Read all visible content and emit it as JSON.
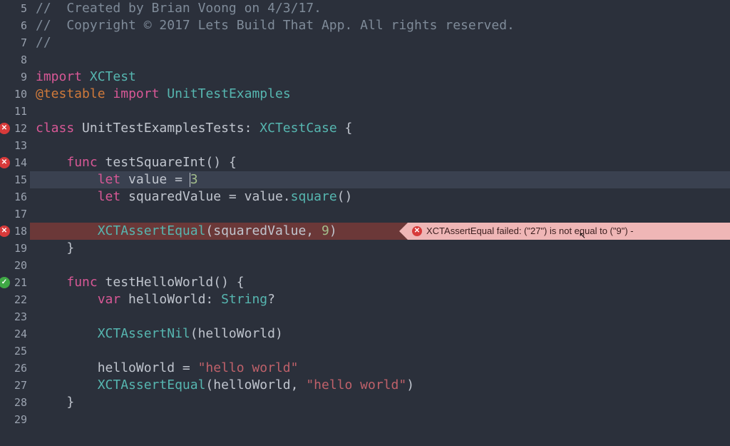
{
  "gutter": {
    "start": 5,
    "end": 29,
    "markers": {
      "12": "err",
      "14": "err",
      "18": "err",
      "21": "ok"
    }
  },
  "code": {
    "l5": {
      "tokens": [
        {
          "t": "//  Created by Brian Voong on 4/3/17.",
          "c": "comment"
        }
      ]
    },
    "l6": {
      "tokens": [
        {
          "t": "//  Copyright © 2017 Lets Build That App. All rights reserved.",
          "c": "comment"
        }
      ]
    },
    "l7": {
      "tokens": [
        {
          "t": "//",
          "c": "comment"
        }
      ]
    },
    "l8": {
      "tokens": []
    },
    "l9": {
      "tokens": [
        {
          "t": "import",
          "c": "keyword"
        },
        {
          "t": " ",
          "c": "plain"
        },
        {
          "t": "XCTest",
          "c": "type"
        }
      ]
    },
    "l10": {
      "tokens": [
        {
          "t": "@testable",
          "c": "attrib"
        },
        {
          "t": " ",
          "c": "plain"
        },
        {
          "t": "import",
          "c": "keyword"
        },
        {
          "t": " ",
          "c": "plain"
        },
        {
          "t": "UnitTestExamples",
          "c": "type"
        }
      ]
    },
    "l11": {
      "tokens": []
    },
    "l12": {
      "tokens": [
        {
          "t": "class",
          "c": "keyword"
        },
        {
          "t": " ",
          "c": "plain"
        },
        {
          "t": "UnitTestExamplesTests",
          "c": "ident"
        },
        {
          "t": ": ",
          "c": "plain"
        },
        {
          "t": "XCTestCase",
          "c": "type"
        },
        {
          "t": " {",
          "c": "plain"
        }
      ]
    },
    "l13": {
      "tokens": []
    },
    "l14": {
      "tokens": [
        {
          "t": "    ",
          "c": "plain"
        },
        {
          "t": "func",
          "c": "keyword"
        },
        {
          "t": " testSquareInt() {",
          "c": "plain"
        }
      ]
    },
    "l15": {
      "tokens": [
        {
          "t": "        ",
          "c": "plain"
        },
        {
          "t": "let",
          "c": "keyword"
        },
        {
          "t": " value = ",
          "c": "plain"
        },
        {
          "t": "3",
          "c": "number",
          "cursorBefore": true
        }
      ]
    },
    "l16": {
      "tokens": [
        {
          "t": "        ",
          "c": "plain"
        },
        {
          "t": "let",
          "c": "keyword"
        },
        {
          "t": " squaredValue = value.",
          "c": "plain"
        },
        {
          "t": "square",
          "c": "func"
        },
        {
          "t": "()",
          "c": "plain"
        }
      ]
    },
    "l17": {
      "tokens": []
    },
    "l18": {
      "tokens": [
        {
          "t": "        ",
          "c": "plain"
        },
        {
          "t": "XCTAssertEqual",
          "c": "func"
        },
        {
          "t": "(squaredValue, ",
          "c": "plain"
        },
        {
          "t": "9",
          "c": "number"
        },
        {
          "t": ")",
          "c": "plain"
        }
      ]
    },
    "l19": {
      "tokens": [
        {
          "t": "    }",
          "c": "plain"
        }
      ]
    },
    "l20": {
      "tokens": []
    },
    "l21": {
      "tokens": [
        {
          "t": "    ",
          "c": "plain"
        },
        {
          "t": "func",
          "c": "keyword"
        },
        {
          "t": " testHelloWorld() {",
          "c": "plain"
        }
      ]
    },
    "l22": {
      "tokens": [
        {
          "t": "        ",
          "c": "plain"
        },
        {
          "t": "var",
          "c": "keyword"
        },
        {
          "t": " helloWorld: ",
          "c": "plain"
        },
        {
          "t": "String",
          "c": "type"
        },
        {
          "t": "?",
          "c": "plain"
        }
      ]
    },
    "l23": {
      "tokens": []
    },
    "l24": {
      "tokens": [
        {
          "t": "        ",
          "c": "plain"
        },
        {
          "t": "XCTAssertNil",
          "c": "func"
        },
        {
          "t": "(helloWorld)",
          "c": "plain"
        }
      ]
    },
    "l25": {
      "tokens": []
    },
    "l26": {
      "tokens": [
        {
          "t": "        helloWorld = ",
          "c": "plain"
        },
        {
          "t": "\"hello world\"",
          "c": "string"
        }
      ]
    },
    "l27": {
      "tokens": [
        {
          "t": "        ",
          "c": "plain"
        },
        {
          "t": "XCTAssertEqual",
          "c": "func"
        },
        {
          "t": "(helloWorld, ",
          "c": "plain"
        },
        {
          "t": "\"hello world\"",
          "c": "string"
        },
        {
          "t": ")",
          "c": "plain"
        }
      ]
    },
    "l28": {
      "tokens": [
        {
          "t": "    }",
          "c": "plain"
        }
      ]
    },
    "l29": {
      "tokens": []
    }
  },
  "currentLine": 15,
  "errorLine": 18,
  "inlineError": {
    "text": "XCTAssertEqual failed: (\"27\") is not equal to (\"9\") -"
  },
  "markerGlyphs": {
    "err": "✕",
    "ok": "✓"
  },
  "cursorArrowGlyph": "↖"
}
